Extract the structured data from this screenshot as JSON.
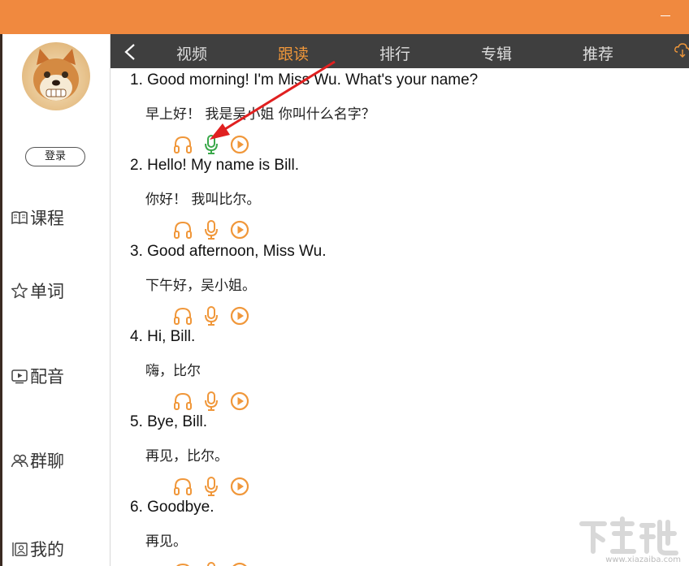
{
  "titlebar": {
    "minimize_icon": "minimize-icon"
  },
  "sidebar": {
    "login_label": "登录",
    "items": [
      {
        "label": "课程",
        "icon": "book-icon"
      },
      {
        "label": "单词",
        "icon": "star-icon"
      },
      {
        "label": "配音",
        "icon": "video-icon"
      },
      {
        "label": "群聊",
        "icon": "people-icon"
      },
      {
        "label": "我的",
        "icon": "user-icon"
      }
    ]
  },
  "tabs": [
    {
      "label": "视频",
      "active": false
    },
    {
      "label": "跟读",
      "active": true
    },
    {
      "label": "排行",
      "active": false
    },
    {
      "label": "专辑",
      "active": false
    },
    {
      "label": "推荐",
      "active": false
    }
  ],
  "lessons": [
    {
      "num": "1.",
      "en": "Good morning! I'm Miss Wu. What's your name?",
      "zh": "早上好！ 我是吴小姐 你叫什么名字？",
      "record_highlight": true
    },
    {
      "num": "2.",
      "en": "Hello! My name is Bill.",
      "zh": "你好！ 我叫比尔。",
      "record_highlight": false
    },
    {
      "num": "3.",
      "en": "Good afternoon, Miss Wu.",
      "zh": "下午好，吴小姐。",
      "record_highlight": false
    },
    {
      "num": "4.",
      "en": "Hi, Bill.",
      "zh": "嗨，比尔",
      "record_highlight": false
    },
    {
      "num": "5.",
      "en": "Bye, Bill.",
      "zh": "再见，比尔。",
      "record_highlight": false
    },
    {
      "num": "6.",
      "en": "Goodbye.",
      "zh": "再见。",
      "record_highlight": false
    }
  ],
  "colors": {
    "accent": "#f0893f",
    "active_tab": "#f0973a",
    "icon": "#f0973a",
    "mic_highlight": "#3aa84a",
    "arrow": "#e02020",
    "nav_bg": "#3f3f3f"
  },
  "watermark": {
    "text": "www.xiazaiba.com"
  }
}
